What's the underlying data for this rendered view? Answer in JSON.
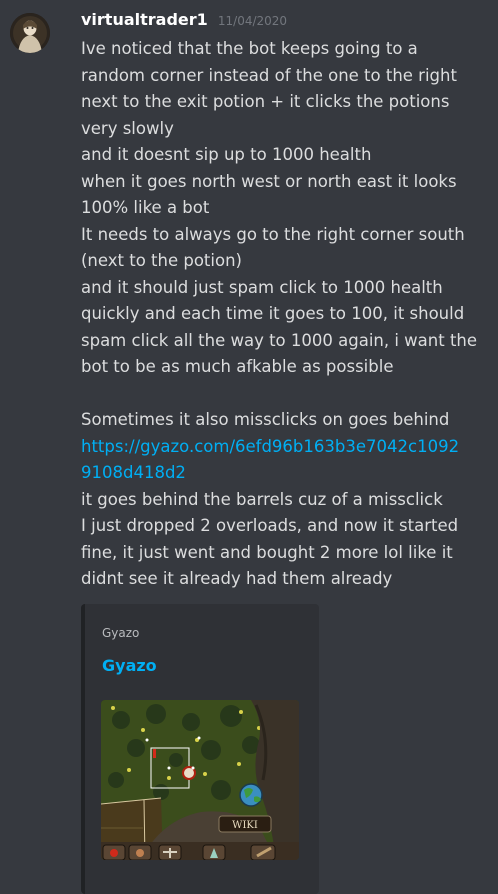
{
  "message": {
    "username": "virtualtrader1",
    "timestamp": "11/04/2020",
    "lines": [
      "Ive noticed that the bot keeps going to a",
      "random corner instead of the one to the right",
      "next to the exit potion + it clicks the potions",
      "very slowly",
      "and it doesnt sip up to 1000 health",
      "when it goes north west or north east it looks",
      "100% like a bot",
      "It needs to always go to the right corner south",
      "(next to the potion)",
      "and it should just spam click to 1000 health",
      "quickly and each time it goes to 100, it should",
      "spam click all the way to 1000 again, i want the",
      "bot to be as much afkable as possible",
      "",
      "Sometimes it also missclicks on goes behind"
    ],
    "link_lines": [
      "https://gyazo.com/6efd96b163b3e7042c1092",
      "9108d418d2"
    ],
    "lines_after": [
      "it goes behind the barrels cuz of a missclick",
      "I just dropped 2 overloads, and now it started",
      "fine, it just went and bought 2 more lol like it",
      "didnt see it already had them already"
    ]
  },
  "embed": {
    "provider": "Gyazo",
    "title": "Gyazo",
    "thumbnail_label": "WIKI"
  },
  "colors": {
    "background": "#36393f",
    "embed_background": "#2f3136",
    "link": "#00aff4",
    "text": "#dcddde",
    "timestamp": "#72767d"
  }
}
